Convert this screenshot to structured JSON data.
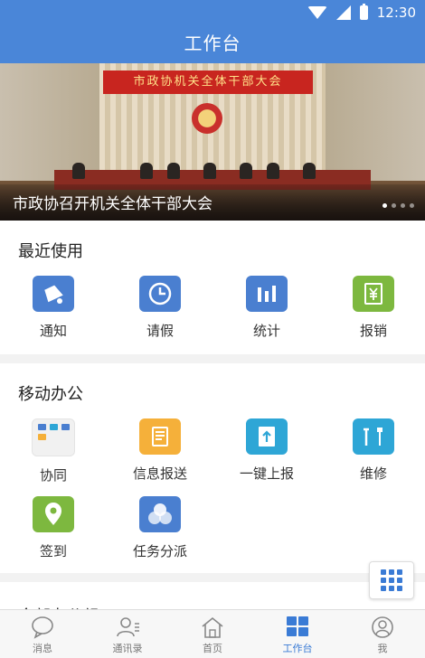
{
  "status_bar": {
    "time": "12:30"
  },
  "header": {
    "title": "工作台"
  },
  "banner": {
    "sign_text": "市政协机关全体干部大会",
    "caption": "市政协召开机关全体干部大会"
  },
  "recent": {
    "title": "最近使用",
    "items": [
      {
        "label": "通知",
        "icon": "bell-icon"
      },
      {
        "label": "请假",
        "icon": "clock-icon"
      },
      {
        "label": "统计",
        "icon": "bar-chart-icon"
      },
      {
        "label": "报销",
        "icon": "receipt-yen-icon"
      }
    ]
  },
  "mobile": {
    "title": "移动办公",
    "items": [
      {
        "label": "协同",
        "icon": "apps-grid-icon"
      },
      {
        "label": "信息报送",
        "icon": "document-icon"
      },
      {
        "label": "一键上报",
        "icon": "upload-icon"
      },
      {
        "label": "维修",
        "icon": "tools-icon"
      },
      {
        "label": "签到",
        "icon": "location-pin-icon"
      },
      {
        "label": "任务分派",
        "icon": "circles-icon"
      }
    ]
  },
  "all": {
    "title": "全部办公组"
  },
  "nav": {
    "tabs": [
      {
        "label": "消息",
        "icon": "chat-icon"
      },
      {
        "label": "通讯录",
        "icon": "contacts-icon"
      },
      {
        "label": "首页",
        "icon": "home-icon"
      },
      {
        "label": "工作台",
        "icon": "workbench-icon",
        "active": true
      },
      {
        "label": "我",
        "icon": "user-icon"
      }
    ]
  },
  "colors": {
    "primary": "#4a86d8",
    "active_tab": "#3a7bd5"
  }
}
